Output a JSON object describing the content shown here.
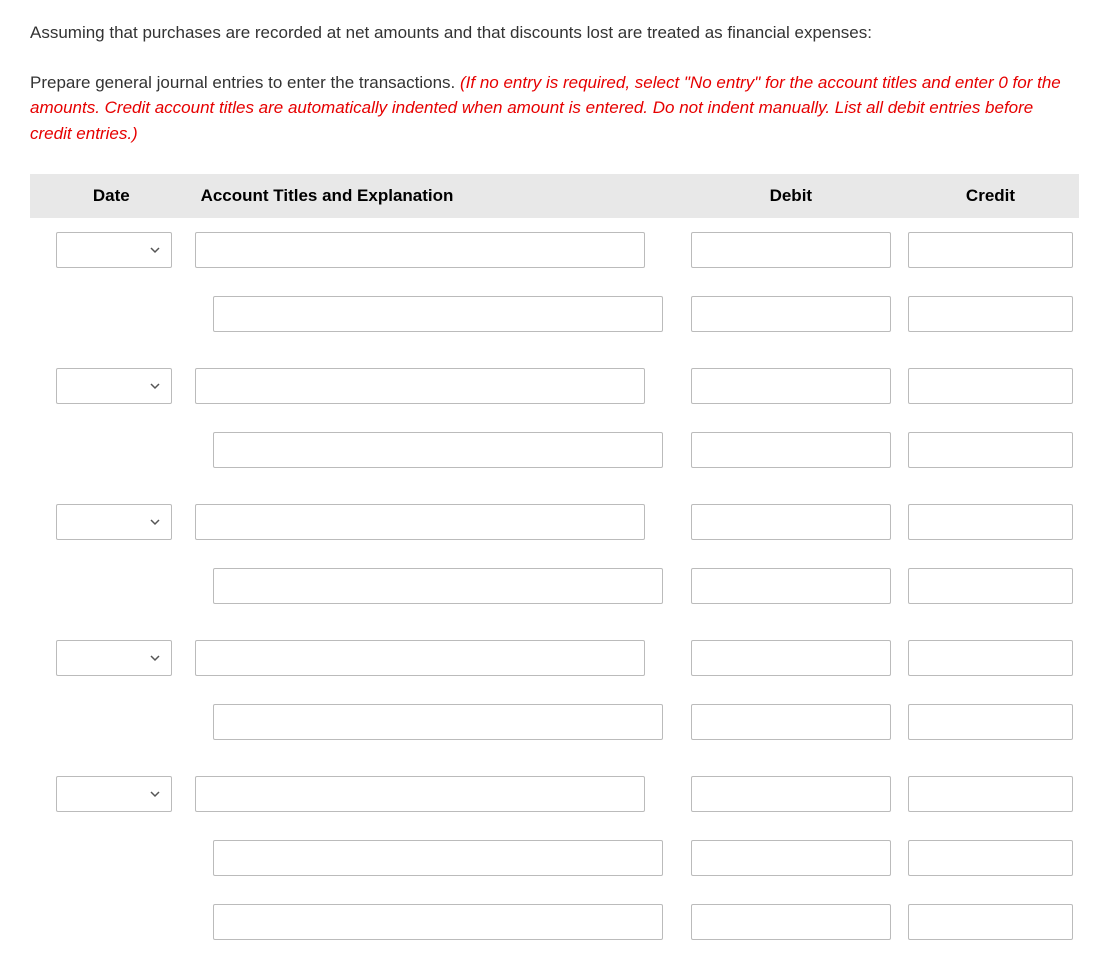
{
  "intro": "Assuming that purchases are recorded at net amounts and that discounts lost are treated as financial expenses:",
  "instructions": {
    "prefix": "Prepare general journal entries to enter the transactions. ",
    "red_text": "(If no entry is required, select \"No entry\" for the account titles and enter 0 for the amounts. Credit account titles are automatically indented when amount is entered. Do not indent manually. List all debit entries before credit entries.)"
  },
  "headers": {
    "date": "Date",
    "account": "Account Titles and Explanation",
    "debit": "Debit",
    "credit": "Credit"
  },
  "groups": [
    {
      "rows": [
        {
          "has_date": true,
          "indented": false
        },
        {
          "has_date": false,
          "indented": true
        }
      ]
    },
    {
      "rows": [
        {
          "has_date": true,
          "indented": false
        },
        {
          "has_date": false,
          "indented": true
        }
      ]
    },
    {
      "rows": [
        {
          "has_date": true,
          "indented": false
        },
        {
          "has_date": false,
          "indented": true
        }
      ]
    },
    {
      "rows": [
        {
          "has_date": true,
          "indented": false
        },
        {
          "has_date": false,
          "indented": true
        }
      ]
    },
    {
      "rows": [
        {
          "has_date": true,
          "indented": false
        },
        {
          "has_date": false,
          "indented": true
        },
        {
          "has_date": false,
          "indented": true
        }
      ]
    }
  ]
}
